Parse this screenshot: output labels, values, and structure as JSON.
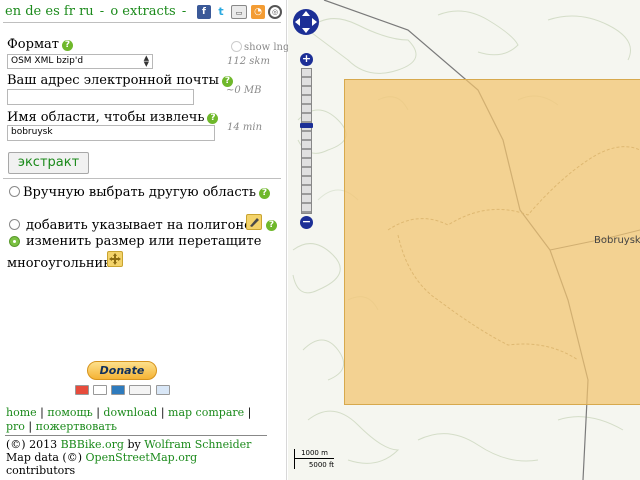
{
  "header": {
    "languages": [
      "en",
      "de",
      "es",
      "fr",
      "ru"
    ],
    "separator": "-",
    "extracts_link": "o extracts",
    "trailing_separator": "-"
  },
  "form": {
    "format_label": "Формат",
    "format_value": "OSM XML bzip'd",
    "show_lng_label": "show lng",
    "format_size_hint": "112 skm",
    "email_label": "Ваш адрес электронной почты",
    "email_value": "",
    "email_hint": "~0 MB",
    "area_label": "Имя области, чтобы извлечь",
    "area_value": "bobruysk",
    "area_hint": "14 min",
    "extract_button": "экстракт"
  },
  "options": {
    "manual_area": "Вручную выбрать другую область",
    "add_polygon_points": "добавить указывает на полигоне",
    "resize_line1": "изменить размер или перетащите",
    "resize_line2": "многоугольник",
    "selected": "resize"
  },
  "donate": {
    "button_label": "Donate",
    "cards": [
      "mastercard",
      "visa",
      "amex",
      "discover",
      "echeck"
    ]
  },
  "nav_links": {
    "home": "home",
    "help": "помощь",
    "download": "download",
    "map_compare": "map compare",
    "pro": "pro",
    "donate": "пожертвовать"
  },
  "footer": {
    "copyright_prefix": "(©) 2013",
    "bbbike": "BBBike.org",
    "by": "by",
    "author": "Wolfram Schneider",
    "map_data_prefix": "Map data (©)",
    "osm": "OpenStreetMap.org",
    "contributors": "contributors"
  },
  "map": {
    "place_label": "Bobruysk",
    "scale_metric": "1000 m",
    "scale_imperial": "5000 ft",
    "selection_color": "#f2c46e",
    "control_color": "#1c2f96"
  },
  "icons": {
    "social": [
      "facebook-icon",
      "twitter-icon",
      "share-icon",
      "rss-icon",
      "settings-icon"
    ]
  }
}
